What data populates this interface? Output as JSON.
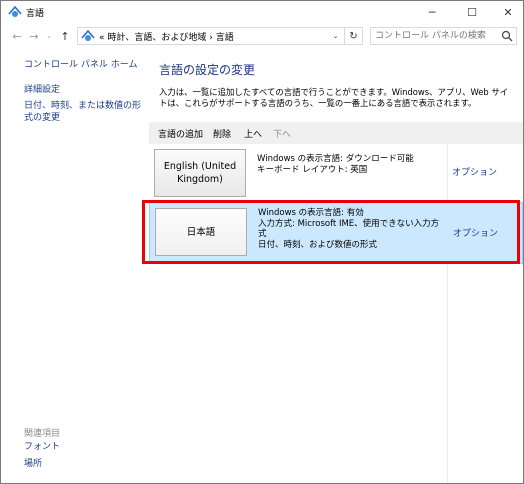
{
  "window": {
    "title": "言語",
    "controls": {
      "minimize": "─",
      "maximize": "☐",
      "close": "✕"
    }
  },
  "nav": {
    "back": "←",
    "forward": "→",
    "recent": "⌄",
    "up": "↑",
    "address": "« 時計、言語、および地域 › 言語",
    "refresh": "↻",
    "search_placeholder": "コントロール パネルの検索"
  },
  "sidebar": {
    "home": "コントロール パネル ホーム",
    "advanced": "詳細設定",
    "date_time_format": "日付、時刻、または数値の形式の変更",
    "related_header": "関連項目",
    "font": "フォント",
    "location": "場所"
  },
  "main": {
    "title": "言語の設定の変更",
    "description": "入力は、一覧に追加したすべての言語で行うことができます。Windows、アプリ、Web サイトは、これらがサポートする言語のうち、一覧の一番上にある言語で表示されます。",
    "toolbar": {
      "add": "言語の追加",
      "remove": "削除",
      "up": "上へ",
      "down": "下へ"
    },
    "languages": [
      {
        "name": "English (United Kingdom)",
        "info": [
          "Windows の表示言語: ダウンロード可能",
          "キーボード レイアウト: 英国"
        ],
        "options": "オプション",
        "selected": false
      },
      {
        "name": "日本語",
        "info": [
          "Windows の表示言語: 有効",
          "入力方式: Microsoft IME、使用できない入力方式",
          "日付、時刻、および数値の形式"
        ],
        "options": "オプション",
        "selected": true
      }
    ]
  },
  "colors": {
    "selection_bg": "#cce8ff",
    "selection_border": "#99d1ff",
    "highlight_box": "#e8000b",
    "link": "#1c3d8b",
    "title": "#1e3287"
  }
}
